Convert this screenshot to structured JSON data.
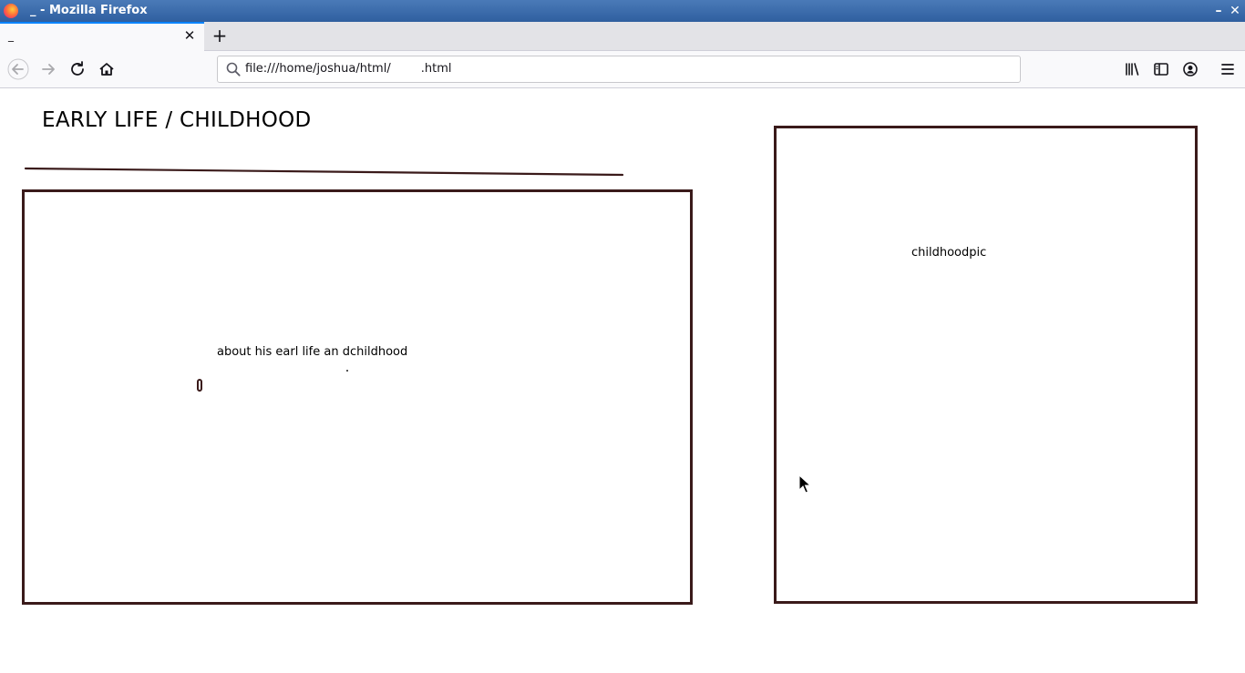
{
  "window": {
    "title": "_ - Mozilla Firefox",
    "minimize_glyph": "–",
    "close_glyph": "✕"
  },
  "tabs": [
    {
      "label": "_",
      "active": true
    }
  ],
  "toolbar": {
    "url": "file:///home/joshua/html/        .html",
    "icons": [
      "back-icon",
      "forward-icon",
      "reload-icon",
      "home-icon",
      "library-icon",
      "sidebar-icon",
      "account-icon",
      "menu-icon"
    ]
  },
  "page": {
    "heading": "EARLY LIFE / CHILDHOOD",
    "about_text": "about his earl life an dchildhood",
    "picture_placeholder": "childhoodpic",
    "border_color": "#3a1a1a"
  }
}
